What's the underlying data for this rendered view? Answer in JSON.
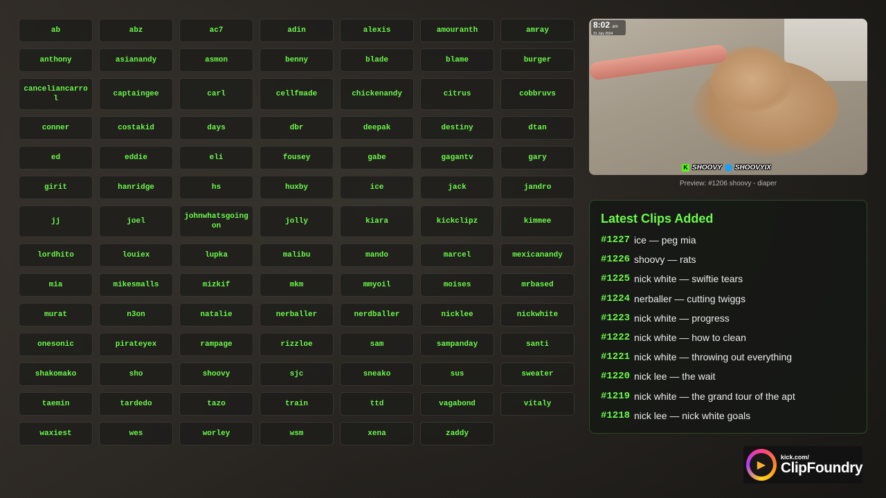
{
  "names": [
    [
      "ab",
      "abz",
      "ac7",
      "adin",
      "alexis",
      "amouranth",
      "amray"
    ],
    [
      "anthony",
      "asianandy",
      "asmon",
      "benny",
      "blade",
      "blame",
      "burger"
    ],
    [
      "canceliancarrol",
      "captaingee",
      "carl",
      "cellfmade",
      "chickenandy",
      "citrus",
      "cobbruvs"
    ],
    [
      "conner",
      "costakid",
      "days",
      "dbr",
      "deepak",
      "destiny",
      "dtan"
    ],
    [
      "ed",
      "eddie",
      "eli",
      "fousey",
      "gabe",
      "gagantv",
      "gary"
    ],
    [
      "girit",
      "hanridge",
      "hs",
      "huxby",
      "ice",
      "jack",
      "jandro"
    ],
    [
      "jj",
      "joel",
      "johnwhatsgoingon",
      "jolly",
      "kiara",
      "kickclipz",
      "kimmee"
    ],
    [
      "lordhito",
      "louiex",
      "lupka",
      "malibu",
      "mando",
      "marcel",
      "mexicanandy"
    ],
    [
      "mia",
      "mikesmalls",
      "mizkif",
      "mkm",
      "mmyoil",
      "moises",
      "mrbased"
    ],
    [
      "murat",
      "n3on",
      "natalie",
      "nerballer",
      "nerdballer",
      "nicklee",
      "nickwhite"
    ],
    [
      "onesonic",
      "pirateyex",
      "rampage",
      "rizzloe",
      "sam",
      "sampanday",
      "santi"
    ],
    [
      "shakomako",
      "sho",
      "shoovy",
      "sjc",
      "sneako",
      "sus",
      "sweater"
    ],
    [
      "taemin",
      "tardedo",
      "tazo",
      "train",
      "ttd",
      "vagabond",
      "vitaly"
    ],
    [
      "waxiest",
      "wes",
      "worley",
      "wsm",
      "xena",
      "zaddy"
    ]
  ],
  "preview": {
    "clock_time": "8:02",
    "clock_ampm": "am",
    "clock_date": "31 July 2024",
    "kick_handle": "SHOOVY",
    "twitter_handle": "SHOOVYIX",
    "caption": "Preview: #1206 shoovy - diaper"
  },
  "clips": {
    "title": "Latest Clips Added",
    "items": [
      {
        "num": "#1227",
        "text": "ice — peg mia"
      },
      {
        "num": "#1226",
        "text": "shoovy — rats"
      },
      {
        "num": "#1225",
        "text": "nick white — swiftie tears"
      },
      {
        "num": "#1224",
        "text": "nerballer — cutting twiggs"
      },
      {
        "num": "#1223",
        "text": "nick white — progress"
      },
      {
        "num": "#1222",
        "text": "nick white — how to clean"
      },
      {
        "num": "#1221",
        "text": "nick white — throwing out everything"
      },
      {
        "num": "#1220",
        "text": "nick lee — the wait"
      },
      {
        "num": "#1219",
        "text": "nick white — the grand tour of the apt"
      },
      {
        "num": "#1218",
        "text": "nick lee — nick white goals"
      }
    ]
  },
  "brand": {
    "small": "kick.com/",
    "big": "ClipFoundry"
  },
  "colors": {
    "accent": "#6bfa4a",
    "kick": "#53fc18",
    "twitter": "#1da1f2"
  }
}
